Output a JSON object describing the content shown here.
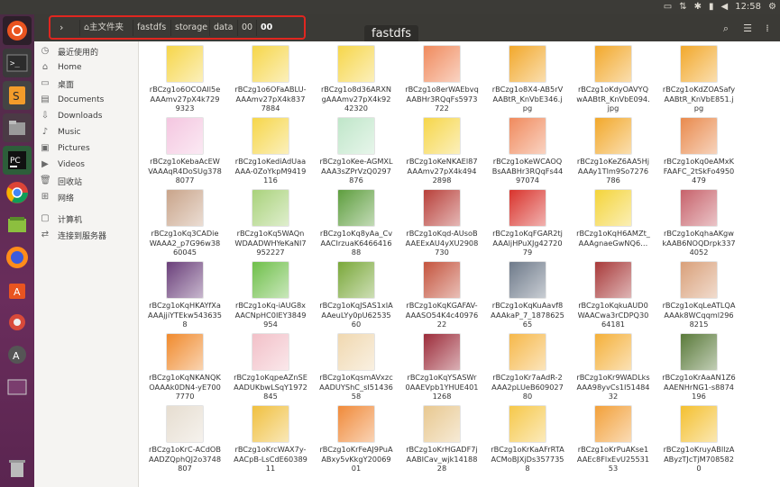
{
  "topbar": {
    "clock": "12:58"
  },
  "header": {
    "title": "fastdfs",
    "crumbs": [
      "主文件夹",
      "fastdfs",
      "storage",
      "data",
      "00",
      "00"
    ]
  },
  "sidebar": {
    "items": [
      {
        "label": "最近使用的",
        "icon": "clock-icon"
      },
      {
        "label": "Home",
        "icon": "home-icon"
      },
      {
        "label": "桌面",
        "icon": "folder-icon"
      },
      {
        "label": "Documents",
        "icon": "document-icon"
      },
      {
        "label": "Downloads",
        "icon": "download-icon"
      },
      {
        "label": "Music",
        "icon": "music-icon"
      },
      {
        "label": "Pictures",
        "icon": "picture-icon"
      },
      {
        "label": "Videos",
        "icon": "video-icon"
      },
      {
        "label": "回收站",
        "icon": "trash-icon"
      },
      {
        "label": "网络",
        "icon": "network-icon"
      },
      {
        "label": "计算机",
        "icon": "computer-icon"
      },
      {
        "label": "连接到服务器",
        "icon": "server-icon"
      }
    ]
  },
  "files": [
    {
      "name": "rBCzg1o6OCOAIl5eAAAmv27pX4k7299323",
      "color": "#f6d64a"
    },
    {
      "name": "rBCzg1o6OFaABLU-AAAmv27pX4k8377884",
      "color": "#f6d64a"
    },
    {
      "name": "rBCzg1o8d36ARXNgAAAmv27pX4k9242320",
      "color": "#f6d64a"
    },
    {
      "name": "rBCzg1o8erWAEbvqAABHr3RQqFs5973722",
      "color": "#f08a5d"
    },
    {
      "name": "rBCzg1o8X4-AB5rVAABtR_KnVbE346.jpg",
      "color": "#f2a82b"
    },
    {
      "name": "rBCzg1oKdyOAVYQwAABtR_KnVbE094.jpg",
      "color": "#f2a82b"
    },
    {
      "name": "rBCzg1oKdZOASafyAABtR_KnVbE851.jpg",
      "color": "#f2a82b"
    },
    {
      "name": "rBCzg1oKebaAcEWVAAAqR4DoSUg3788077",
      "color": "#f4c6e0"
    },
    {
      "name": "rBCzg1oKediAdUaaAAA-0ZoYkpM9419116",
      "color": "#f6d64a"
    },
    {
      "name": "rBCzg1oKee-AGMXLAAA3sZPrVzQ0297876",
      "color": "#bfe6c9"
    },
    {
      "name": "rBCzg1oKeNKAEl87AAAmv27pX4k4942898",
      "color": "#f6d64a"
    },
    {
      "name": "rBCzg1oKeWCAOQBsAABHr3RQqFs4497074",
      "color": "#f08a5d"
    },
    {
      "name": "rBCzg1oKeZ6AA5HjAAAy1Tlm9So7276786",
      "color": "#f2a82b"
    },
    {
      "name": "rBCzg1oKq0eAMxKFAAFC_2tSkFo4950479",
      "color": "#e98a4d"
    },
    {
      "name": "rBCzg1oKq3CADieWAAA2_p7G96w3860045",
      "color": "#c9a48a"
    },
    {
      "name": "rBCzg1oKq5WAQnWDAADWHYeKaNI7952227",
      "color": "#a9d27b"
    },
    {
      "name": "rBCzg1oKq8yAa_CvAACIrzuaK646641688",
      "color": "#5e9e3e"
    },
    {
      "name": "rBCzg1oKqd-AUsoBAAEExAU4yXU2908730",
      "color": "#b8403a"
    },
    {
      "name": "rBCzg1oKqFGAR2tjAAAljHPuXJg4272079",
      "color": "#d9332c"
    },
    {
      "name": "rBCzg1oKqH6AMZt_AAAgnaeGwNQ6…",
      "color": "#f4d43a"
    },
    {
      "name": "rBCzg1oKqhaAKgwkAAB6NOQDrpk3374052",
      "color": "#c7626b"
    },
    {
      "name": "rBCzg1oKqHKAYfXaAAAjjiYTEkw5436358",
      "color": "#6a3f7a"
    },
    {
      "name": "rBCzg1oKq-iAUG8xAACNpHC0IEY3849954",
      "color": "#6fbf4a"
    },
    {
      "name": "rBCzg1oKqJSAS1xIAAAeuLYy0pU6253560",
      "color": "#7aa83a"
    },
    {
      "name": "rBCzg1oKqKGAFAV-AAASO54K4c4097622",
      "color": "#c4543e"
    },
    {
      "name": "rBCzg1oKqKuAavf8AAAkaP_7_187862565",
      "color": "#6e7a8a"
    },
    {
      "name": "rBCzg1oKqkuAUD0WAACwa3rCDPQ3064181",
      "color": "#a83a3a"
    },
    {
      "name": "rBCzg1oKqLeATLQAAAAk8WCqqml2968215",
      "color": "#d9a07a"
    },
    {
      "name": "rBCzg1oKqNKANQKOAAAk0DN4-yE7007770",
      "color": "#f08a2d"
    },
    {
      "name": "rBCzg1oKqpeAZnSEAADUKbwLSqY1972845",
      "color": "#f2c0c8"
    },
    {
      "name": "rBCzg1oKqsmAVxzcAADUYShC_sI5143658",
      "color": "#f0d8b0"
    },
    {
      "name": "rBCzg1oKqYSASWr0AAEVpb1YHUE4011268",
      "color": "#9c2c3a"
    },
    {
      "name": "rBCzg1oKr7aAdR-2AAA2pLUeB60902780",
      "color": "#f6b84a"
    },
    {
      "name": "rBCzg1oKr9WADLksAAA98yvCs1I5148432",
      "color": "#f4b03a"
    },
    {
      "name": "rBCzg1oKrAaAN1Z6AAENHrNG1-s8874196",
      "color": "#5a7a3a"
    },
    {
      "name": "rBCzg1oKrC-ACdOBAADZQphQJ2o3748807",
      "color": "#e6ddd0"
    },
    {
      "name": "rBCzg1oKrcWAX7y-AACpB-LsCdE6038911",
      "color": "#f0c040"
    },
    {
      "name": "rBCzg1oKrFeAJ9PuAABxy5vKkgY2006901",
      "color": "#f08a3a"
    },
    {
      "name": "rBCzg1oKrHGADF7jAABICav_wjk1418828",
      "color": "#e8c890"
    },
    {
      "name": "rBCzg1oKrKaAFrRTAACMoBJXjDs3577358",
      "color": "#f6c84a"
    },
    {
      "name": "rBCzg1oKrPuAKse1AAEc8FlxEvU25531 53",
      "color": "#f2a03a"
    },
    {
      "name": "rBCzg1oKruyABIlzAAByzTJcTjM7085820",
      "color": "#f4c030"
    }
  ]
}
